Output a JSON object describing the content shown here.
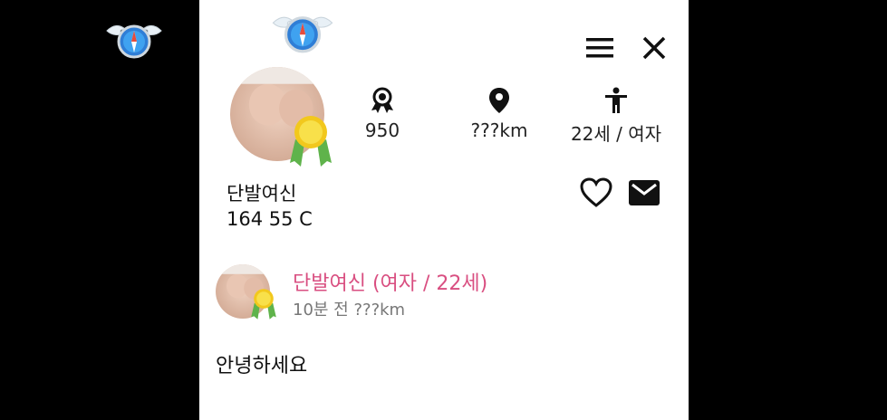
{
  "icons": {
    "logo": "winged-compass-logo",
    "menu": "hamburger-menu-icon",
    "close": "close-icon",
    "rank": "award-ribbon-icon",
    "location": "map-pin-icon",
    "person": "person-icon",
    "heart": "heart-outline-icon",
    "mail": "envelope-icon",
    "badge": "gold-medal-badge"
  },
  "profile": {
    "stats": [
      {
        "icon": "award-ribbon-icon",
        "value": "950"
      },
      {
        "icon": "map-pin-icon",
        "value": "???km"
      },
      {
        "icon": "person-icon",
        "value": "22세 / 여자"
      }
    ],
    "name": "단발여신",
    "detail": "164 55 C"
  },
  "post": {
    "author": "단발여신 (여자 / 22세)",
    "meta": "10분 전  ???km",
    "body": "안녕하세요"
  },
  "colors": {
    "accent_pink": "#d94f81",
    "meta_gray": "#777777",
    "background": "#000000",
    "panel": "#ffffff"
  }
}
